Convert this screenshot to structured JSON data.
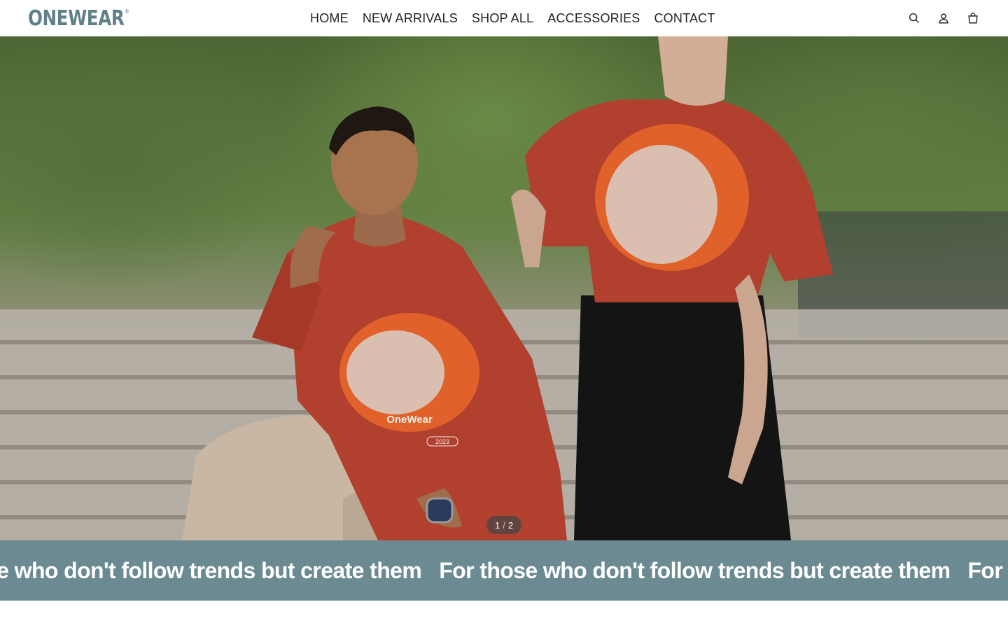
{
  "brand": {
    "logo_text": "ONEWEAR",
    "logo_mark": "®",
    "color": "#5f8088"
  },
  "nav": {
    "items": [
      {
        "label": "HOME"
      },
      {
        "label": "NEW ARRIVALS"
      },
      {
        "label": "SHOP ALL"
      },
      {
        "label": "ACCESSORIES"
      },
      {
        "label": "CONTACT"
      }
    ]
  },
  "header_icons": [
    "search-icon",
    "account-icon",
    "cart-icon"
  ],
  "hero": {
    "shirt_print": {
      "brand": "OneWear",
      "year": "2023"
    },
    "slide_current": "1",
    "slide_separator": "/",
    "slide_total": "2"
  },
  "marquee": {
    "background": "#6b8a92",
    "items": [
      "For those who don't follow trends but create them",
      "For those who don't follow trends but create them",
      "For those who don't follow trends but create them"
    ]
  }
}
